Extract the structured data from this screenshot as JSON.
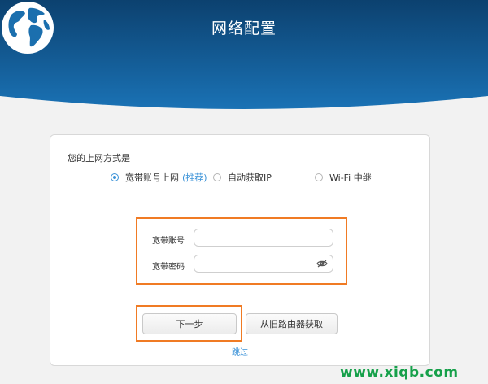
{
  "header": {
    "title": "网络配置"
  },
  "connection": {
    "question": "您的上网方式是",
    "options": [
      {
        "label": "宽带账号上网",
        "tag": "(推荐)",
        "selected": true
      },
      {
        "label": "自动获取IP",
        "selected": false
      },
      {
        "label": "Wi-Fi 中继",
        "selected": false
      }
    ]
  },
  "form": {
    "account_label": "宽带账号",
    "account_value": "",
    "password_label": "宽带密码",
    "password_value": "",
    "password_toggle_icon": "eye-icon"
  },
  "actions": {
    "next_label": "下一步",
    "import_label": "从旧路由器获取",
    "skip_label": "跳过"
  },
  "watermark": "www.xiqb.com",
  "colors": {
    "header_dark": "#0d4a7c",
    "header_light": "#1b78bd",
    "accent": "#3a92d8",
    "highlight": "#f07b24",
    "watermark": "#16a04a"
  }
}
